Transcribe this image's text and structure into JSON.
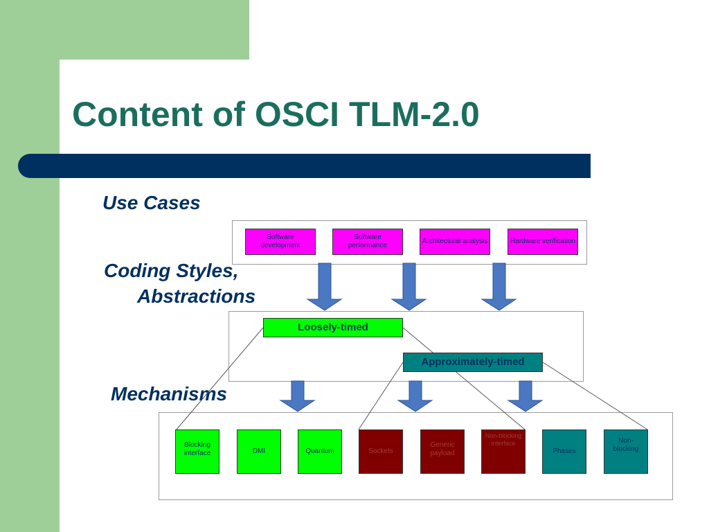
{
  "title": "Content of OSCI TLM-2.0",
  "labels": {
    "use_cases": "Use Cases",
    "coding_styles_1": "Coding Styles,",
    "coding_styles_2": "Abstractions",
    "mechanisms": "Mechanisms"
  },
  "use_cases": [
    "Software development",
    "Software performance",
    "Architectural analysis",
    "Hardware verification"
  ],
  "coding_styles": [
    "Loosely-timed",
    "Approximately-timed"
  ],
  "mechanisms": [
    "Blocking interface",
    "DMI",
    "Quantum",
    "Sockets",
    "Generic payload",
    "Non-blocking interface",
    "Phases",
    "Non-blocking"
  ],
  "colors": {
    "title": "#1b6e5e",
    "title_bar": "#00305f",
    "background_accent": "#9ecf98",
    "use_case_fill": "#ff00ff",
    "loosely_timed_fill": "#00ff00",
    "approximately_timed_fill": "#008080",
    "shared_mechanism_fill": "#800000",
    "arrow": "#4a78c2"
  }
}
